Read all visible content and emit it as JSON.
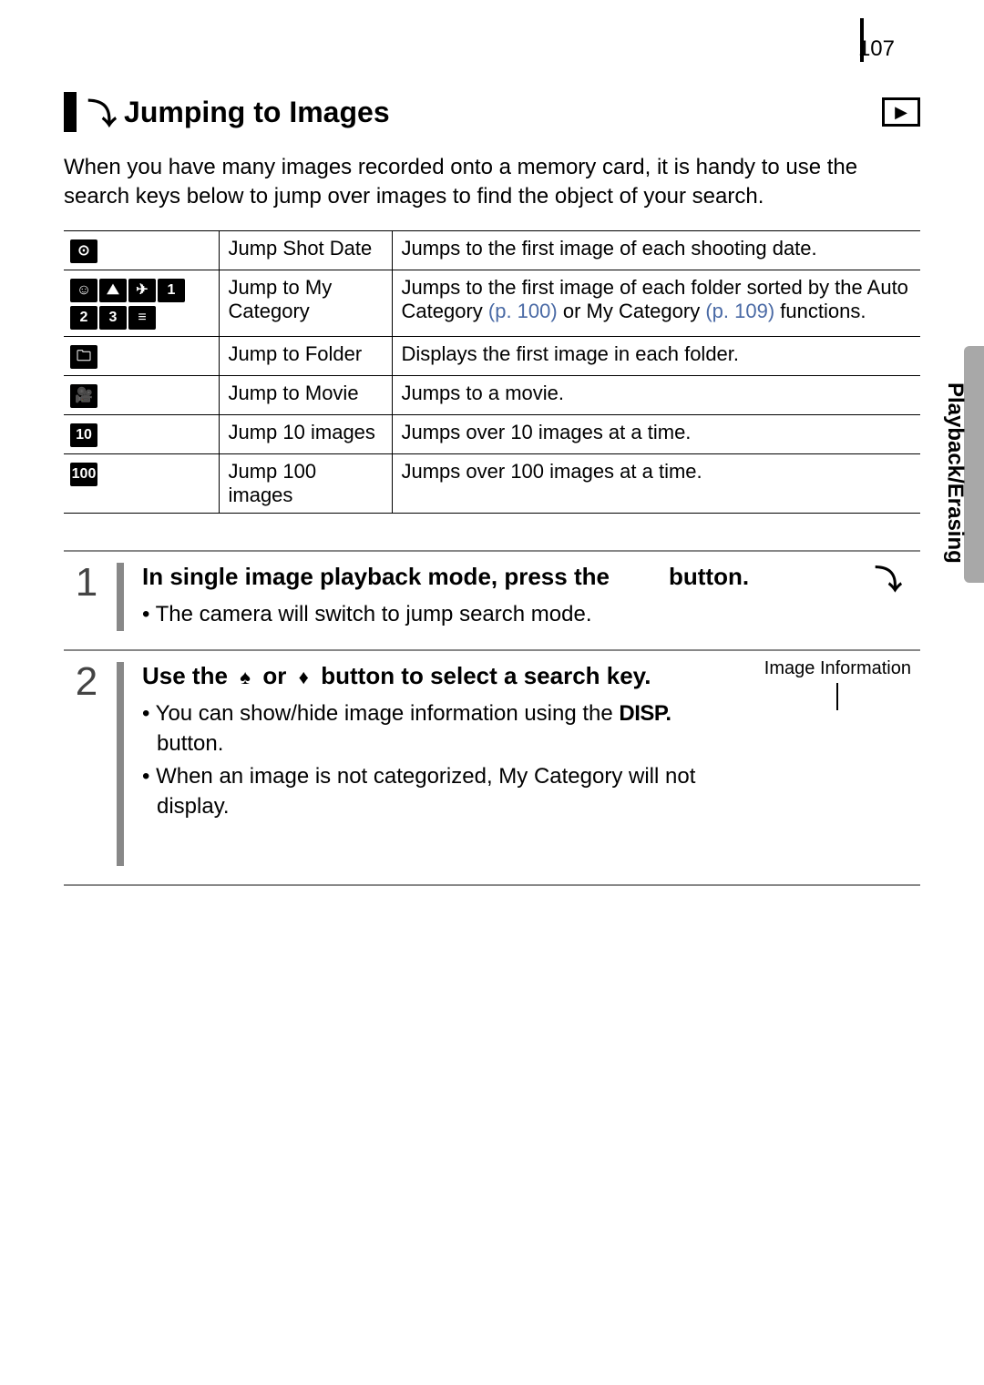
{
  "pageNumber": "107",
  "sideTab": "Playback/Erasing",
  "section": {
    "title": "Jumping to Images",
    "intro": "When you have many images recorded onto a memory card, it is handy to use the search keys below to jump over images to find the object of your search."
  },
  "table": {
    "rows": [
      {
        "icons": "shot-date-icon",
        "name": "Jump Shot Date",
        "desc": "Jumps to the first image of each shooting date."
      },
      {
        "icons": "category-icons",
        "name": "Jump to My Category",
        "desc_prefix": "Jumps to the first image of each folder sorted by the Auto Category ",
        "link1": "(p. 100)",
        "desc_mid": " or My Category ",
        "link2": "(p. 109)",
        "desc_suffix": " functions."
      },
      {
        "icons": "folder-icon",
        "name": "Jump to Folder",
        "desc": "Displays the first image in each folder."
      },
      {
        "icons": "movie-icon",
        "name": "Jump to Movie",
        "desc": "Jumps to a movie."
      },
      {
        "icons": "jump10-icon",
        "name": "Jump 10 images",
        "desc": "Jumps over 10 images at a time."
      },
      {
        "icons": "jump100-icon",
        "name": "Jump 100 images",
        "desc": "Jumps over 100 images at a time."
      }
    ]
  },
  "steps": [
    {
      "num": "1",
      "title_prefix": "In single image playback mode, press the ",
      "title_suffix": " button.",
      "bullets": [
        "The camera will switch to jump search mode."
      ]
    },
    {
      "num": "2",
      "title_prefix": "Use the ",
      "title_mid_or": "or",
      "title_suffix": "button to select a search key.",
      "callout": "Image Information",
      "bullets": [
        {
          "pre": "You can show/hide image information using the ",
          "disp": "DISP.",
          "post": " button."
        },
        {
          "text": "When an image is not categorized, My Category will not display."
        }
      ]
    }
  ]
}
